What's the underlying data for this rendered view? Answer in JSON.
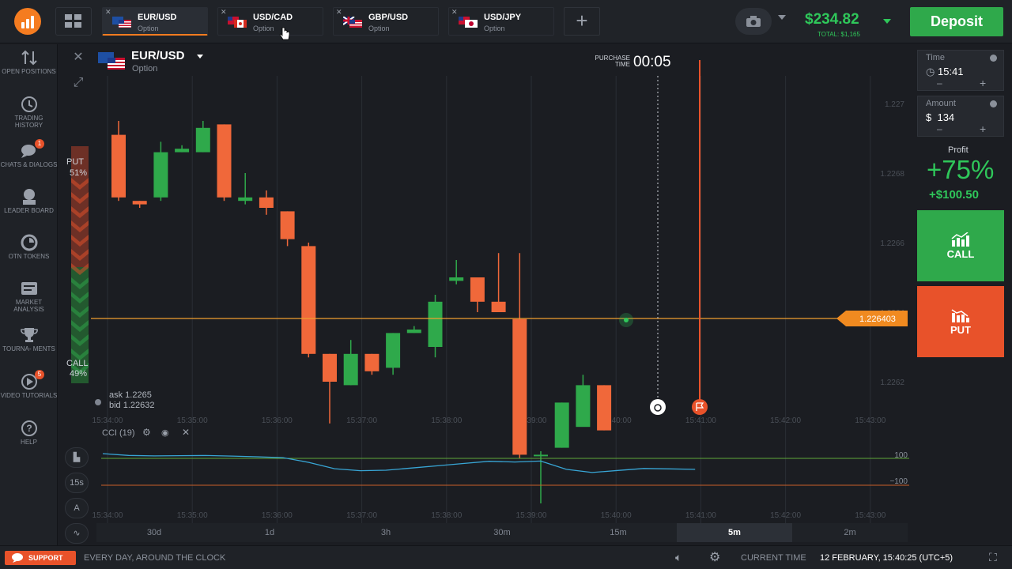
{
  "header": {
    "tabs": [
      {
        "pair": "EUR/USD",
        "type": "Option"
      },
      {
        "pair": "USD/CAD",
        "type": "Option"
      },
      {
        "pair": "GBP/USD",
        "type": "Option"
      },
      {
        "pair": "USD/JPY",
        "type": "Option"
      }
    ],
    "add_tab": "+",
    "balance": "$234.82",
    "total": "TOTAL: $1,165",
    "deposit_label": "Deposit"
  },
  "sidebar": {
    "items": [
      {
        "label": "OPEN POSITIONS",
        "icon": "arrows-updown-icon"
      },
      {
        "label": "TRADING HISTORY",
        "icon": "history-icon"
      },
      {
        "label": "CHATS & DIALOGS",
        "icon": "chat-icon",
        "badge": "1"
      },
      {
        "label": "LEADER BOARD",
        "icon": "leaderboard-icon"
      },
      {
        "label": "OTN TOKENS",
        "icon": "token-icon"
      },
      {
        "label": "MARKET ANALYSIS",
        "icon": "market-analysis-icon"
      },
      {
        "label": "TOURNA- MENTS",
        "icon": "trophy-icon"
      },
      {
        "label": "VIDEO TUTORIALS",
        "icon": "video-icon",
        "badge": "5"
      },
      {
        "label": "HELP",
        "icon": "help-icon"
      }
    ]
  },
  "asset": {
    "name": "EUR/USD",
    "type": "Option"
  },
  "purchase": {
    "label": "PURCHASE TIME",
    "countdown": "00:05"
  },
  "sentiment": {
    "put_label": "PUT",
    "put_value": "51%",
    "call_label": "CALL",
    "call_value": "49%"
  },
  "quotes": {
    "ask": "ask 1.2265",
    "bid": "bid 1.22632"
  },
  "indicator": {
    "label": "CCI (19)",
    "upper": "100",
    "lower": "−100",
    "timeframe_btn": "15s"
  },
  "chart_data": {
    "type": "candlestick",
    "instrument": "EUR/USD",
    "current_price": "1.226403",
    "y_ticks": [
      "1.227",
      "1.2268",
      "1.2266",
      "1.2264",
      "1.2262"
    ],
    "x_ticks": [
      "15:34:00",
      "15:35:00",
      "15:36:00",
      "15:37:00",
      "15:38:00",
      "15:39:00",
      "15:40:00",
      "15:41:00",
      "15:42:00",
      "15:43:00"
    ],
    "candles": [
      {
        "o": 1.22691,
        "c": 1.22673,
        "h": 1.22695,
        "l": 1.22672,
        "dir": "down"
      },
      {
        "o": 1.22672,
        "c": 1.22671,
        "h": 1.22672,
        "l": 1.2267,
        "dir": "down"
      },
      {
        "o": 1.22673,
        "c": 1.22686,
        "h": 1.22689,
        "l": 1.22672,
        "dir": "up"
      },
      {
        "o": 1.22686,
        "c": 1.22687,
        "h": 1.22688,
        "l": 1.22686,
        "dir": "up"
      },
      {
        "o": 1.22686,
        "c": 1.22693,
        "h": 1.22695,
        "l": 1.22686,
        "dir": "up"
      },
      {
        "o": 1.22694,
        "c": 1.22673,
        "h": 1.22694,
        "l": 1.22672,
        "dir": "down"
      },
      {
        "o": 1.22672,
        "c": 1.22673,
        "h": 1.2268,
        "l": 1.22671,
        "dir": "up"
      },
      {
        "o": 1.22673,
        "c": 1.2267,
        "h": 1.22675,
        "l": 1.22668,
        "dir": "down"
      },
      {
        "o": 1.22669,
        "c": 1.22661,
        "h": 1.22669,
        "l": 1.22659,
        "dir": "down"
      },
      {
        "o": 1.22659,
        "c": 1.22628,
        "h": 1.2266,
        "l": 1.22627,
        "dir": "down"
      },
      {
        "o": 1.22628,
        "c": 1.2262,
        "h": 1.22628,
        "l": 1.22608,
        "dir": "down"
      },
      {
        "o": 1.22619,
        "c": 1.22628,
        "h": 1.22632,
        "l": 1.22619,
        "dir": "up"
      },
      {
        "o": 1.22628,
        "c": 1.22623,
        "h": 1.22628,
        "l": 1.22622,
        "dir": "down"
      },
      {
        "o": 1.22624,
        "c": 1.22634,
        "h": 1.22634,
        "l": 1.22622,
        "dir": "up"
      },
      {
        "o": 1.22634,
        "c": 1.22635,
        "h": 1.22636,
        "l": 1.22634,
        "dir": "up"
      },
      {
        "o": 1.2263,
        "c": 1.22643,
        "h": 1.22645,
        "l": 1.22627,
        "dir": "up"
      },
      {
        "o": 1.22649,
        "c": 1.2265,
        "h": 1.22655,
        "l": 1.22648,
        "dir": "up"
      },
      {
        "o": 1.2265,
        "c": 1.22643,
        "h": 1.2265,
        "l": 1.2264,
        "dir": "down"
      },
      {
        "o": 1.22643,
        "c": 1.2264,
        "h": 1.22657,
        "l": 1.2264,
        "dir": "down"
      },
      {
        "o": 1.22638,
        "c": 1.22599,
        "h": 1.22657,
        "l": 1.22598,
        "dir": "down"
      },
      {
        "o": 1.22599,
        "c": 1.22599,
        "h": 1.226,
        "l": 1.22585,
        "dir": "up"
      },
      {
        "o": 1.22601,
        "c": 1.22614,
        "h": 1.22614,
        "l": 1.22601,
        "dir": "up"
      },
      {
        "o": 1.22607,
        "c": 1.22619,
        "h": 1.22622,
        "l": 1.22608,
        "dir": "up"
      },
      {
        "o": 1.22619,
        "c": 1.22606,
        "h": 1.22619,
        "l": 1.22606,
        "dir": "down"
      }
    ],
    "cci_series": [
      135,
      122,
      118,
      120,
      121,
      117,
      112,
      105,
      70,
      23,
      8,
      12,
      28,
      45,
      62,
      78,
      73,
      80,
      18,
      -5,
      10,
      25,
      22,
      18
    ]
  },
  "timeframes": [
    "30d",
    "1d",
    "3h",
    "30m",
    "15m",
    "5m",
    "2m"
  ],
  "active_timeframe": "5m",
  "trade": {
    "time_label": "Time",
    "time_value": "15:41",
    "amount_label": "Amount",
    "amount_value": "134",
    "currency": "$",
    "minus": "–",
    "plus": "+",
    "profit_label": "Profit",
    "profit_pct": "+75%",
    "profit_value": "+$100.50",
    "call_label": "CALL",
    "put_label": "PUT"
  },
  "footer": {
    "support": "SUPPORT",
    "tagline": "EVERY DAY, AROUND THE CLOCK",
    "current_time_label": "CURRENT TIME",
    "current_time": "12 FEBRUARY, 15:40:25 (UTC+5)"
  },
  "colors": {
    "up": "#2fa94b",
    "down": "#f0683a",
    "accent": "#f57c20",
    "deposit": "#2fa94b"
  }
}
